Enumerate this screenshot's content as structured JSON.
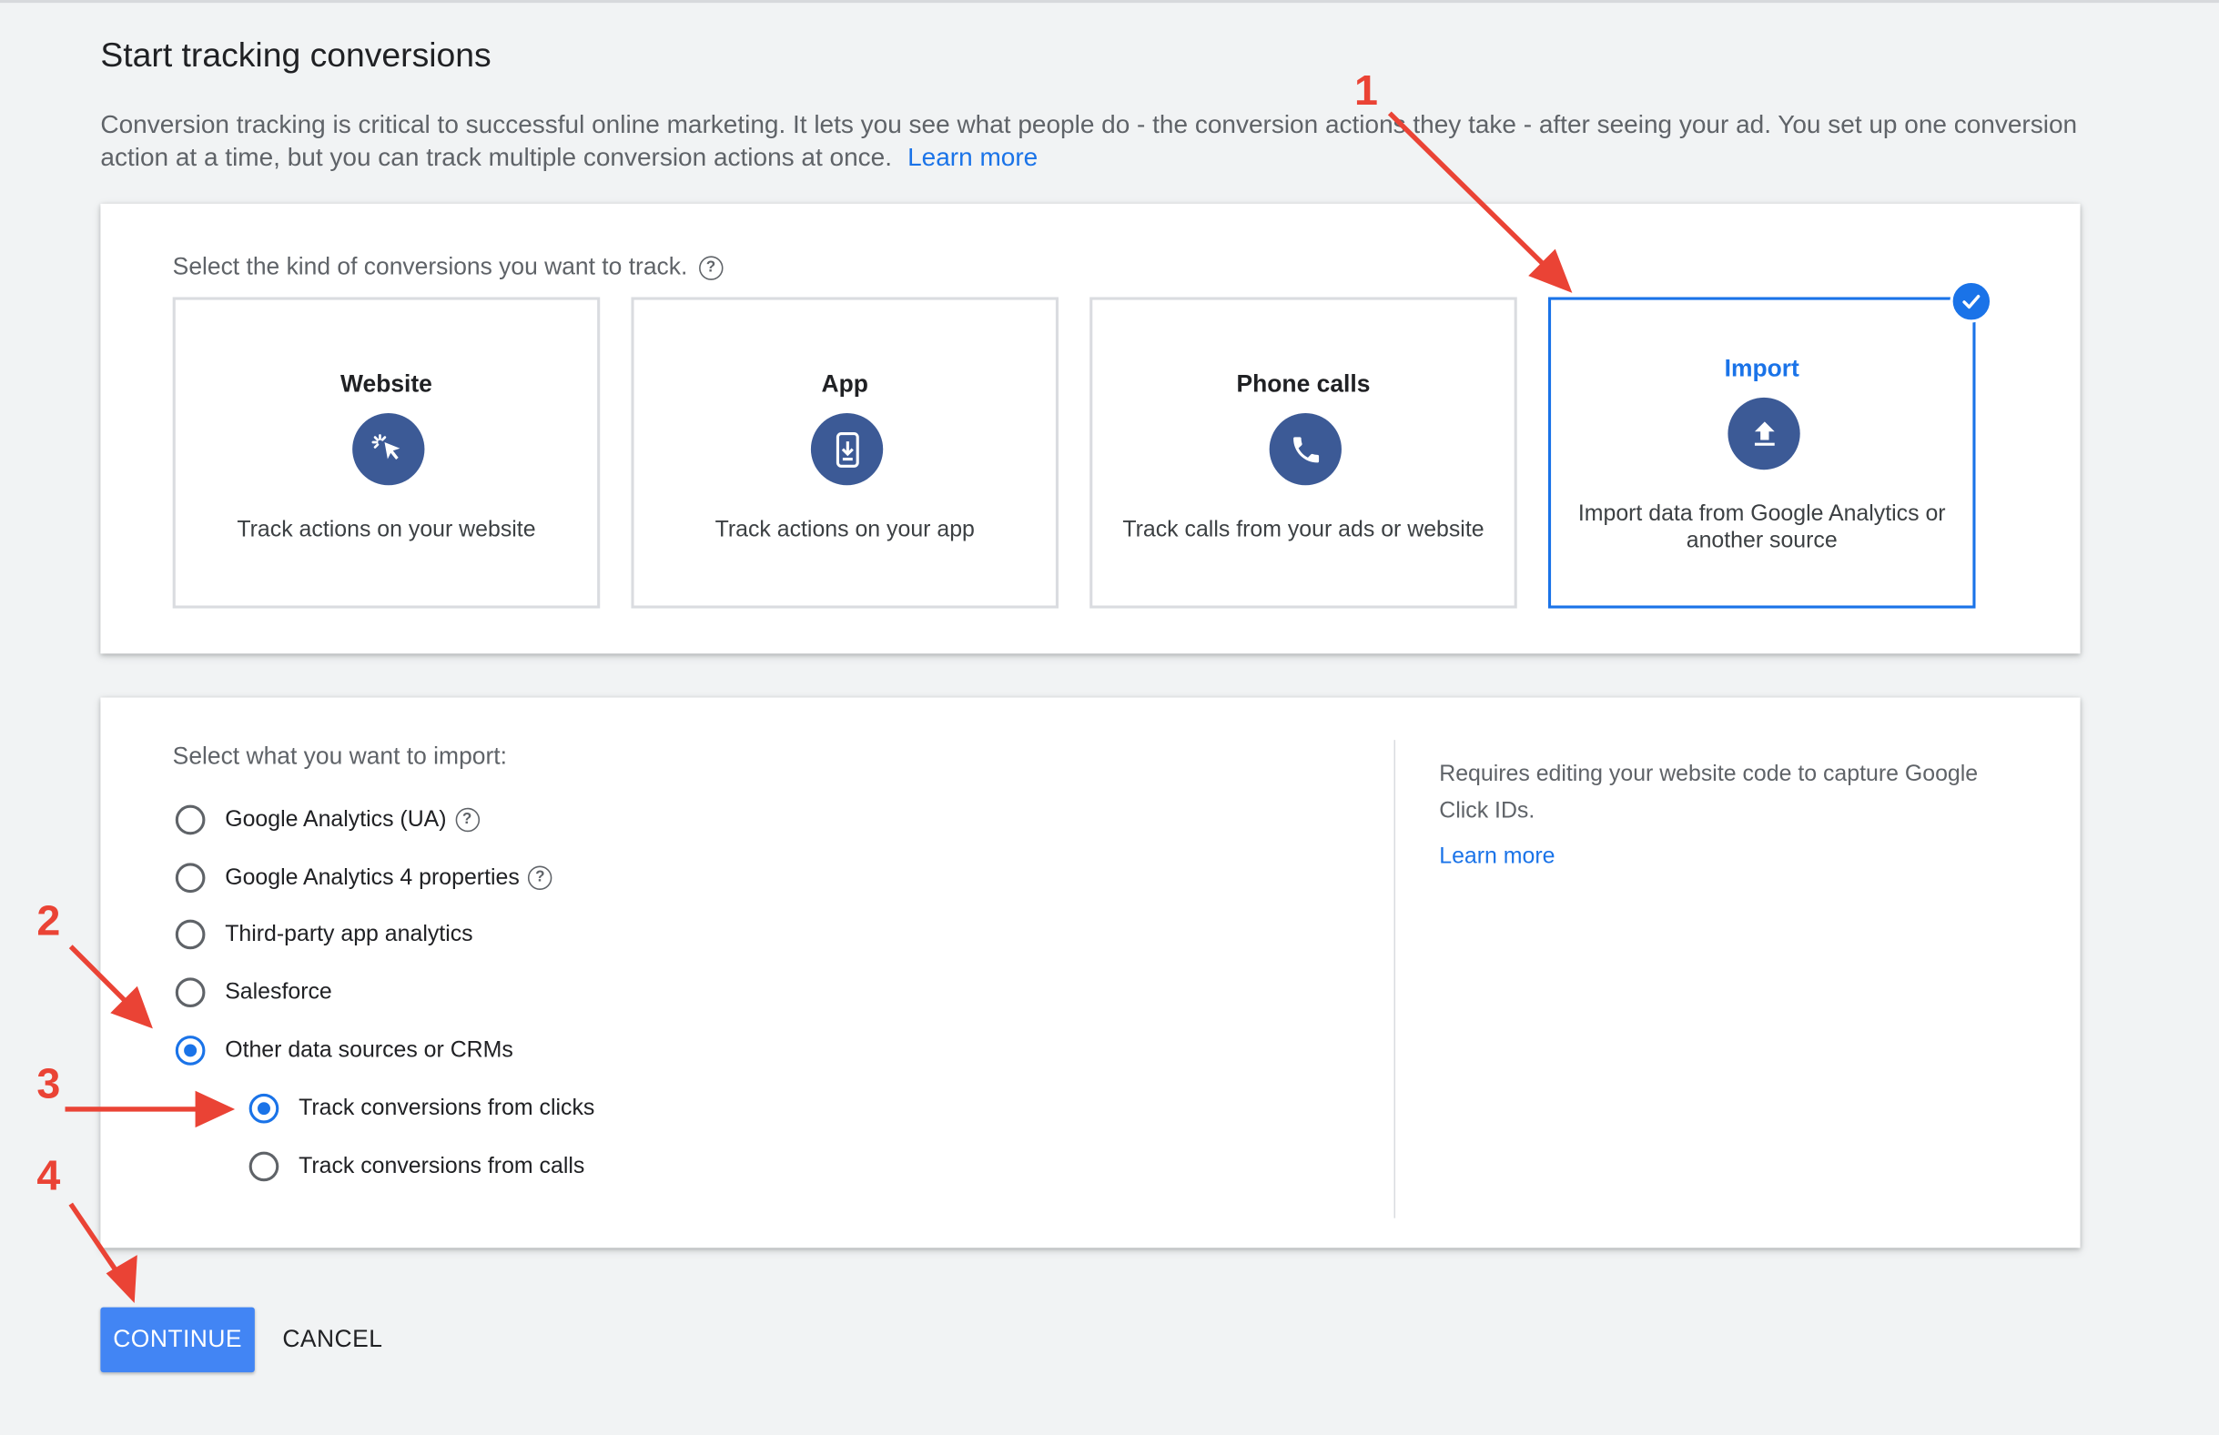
{
  "page": {
    "title": "Start tracking conversions",
    "intro": "Conversion tracking is critical to successful online marketing. It lets you see what people do - the conversion actions they take - after seeing your ad. You set up one conversion action at a time, but you can track multiple conversion actions at once.",
    "learn_more": "Learn more"
  },
  "kinds": {
    "prompt": "Select the kind of conversions you want to track.",
    "help_icon": "help-circle-icon",
    "selected": "Import",
    "tiles": [
      {
        "name": "Website",
        "icon": "cursor-click-icon",
        "desc": "Track actions on your website"
      },
      {
        "name": "App",
        "icon": "smartphone-download-icon",
        "desc": "Track actions on your app"
      },
      {
        "name": "Phone calls",
        "icon": "phone-icon",
        "desc": "Track calls from your ads or website"
      },
      {
        "name": "Import",
        "icon": "upload-icon",
        "desc": "Import data from Google Analytics or another source"
      }
    ]
  },
  "import": {
    "prompt": "Select what you want to import:",
    "options": [
      {
        "label": "Google Analytics (UA)",
        "selected": false,
        "help": true
      },
      {
        "label": "Google Analytics 4 properties",
        "selected": false,
        "help": true
      },
      {
        "label": "Third-party app analytics",
        "selected": false,
        "help": false
      },
      {
        "label": "Salesforce",
        "selected": false,
        "help": false
      },
      {
        "label": "Other data sources or CRMs",
        "selected": true,
        "help": false
      }
    ],
    "sub_options": [
      {
        "label": "Track conversions from clicks",
        "selected": true
      },
      {
        "label": "Track conversions from calls",
        "selected": false
      }
    ],
    "side_note": "Requires editing your website code to capture Google Click IDs.",
    "side_link": "Learn more"
  },
  "actions": {
    "continue": "CONTINUE",
    "cancel": "CANCEL"
  },
  "annotations": {
    "step1": "1",
    "step2": "2",
    "step3": "3",
    "step4": "4",
    "color": "#ea4335"
  },
  "colors": {
    "accent": "#1a73e8",
    "icon_bg": "#3c5a96",
    "button": "#4285f4",
    "background": "#f1f3f4"
  }
}
